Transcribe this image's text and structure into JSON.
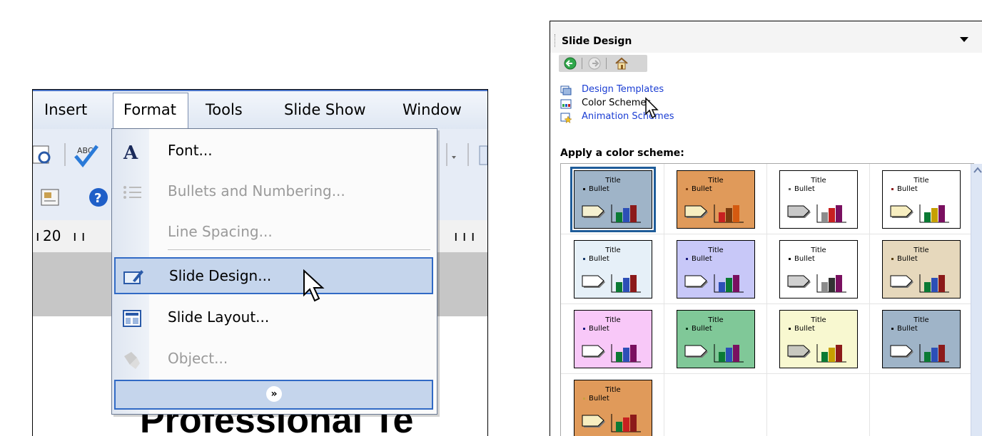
{
  "menubar": {
    "items": [
      "Insert",
      "Format",
      "Tools",
      "Slide Show",
      "Window"
    ]
  },
  "ruler": {
    "mark": "20"
  },
  "format_menu": {
    "items": [
      {
        "label": "Font...",
        "disabled": false,
        "icon": "font-icon"
      },
      {
        "label": "Bullets and Numbering...",
        "disabled": true,
        "icon": "bullets-icon"
      },
      {
        "label": "Line Spacing...",
        "disabled": true,
        "icon": ""
      },
      {
        "label": "Slide Design...",
        "disabled": false,
        "highlighted": true,
        "icon": "slide-design-icon"
      },
      {
        "label": "Slide Layout...",
        "disabled": false,
        "icon": "slide-layout-icon"
      },
      {
        "label": "Object...",
        "disabled": true,
        "icon": "object-icon"
      }
    ],
    "expand_icon": "chevron-double-down-icon"
  },
  "slide": {
    "title_fragment": "Professional Te"
  },
  "task_pane": {
    "title": "Slide Design",
    "links": [
      {
        "label": "Design Templates",
        "link": true
      },
      {
        "label": "Color Schemes",
        "link": false
      },
      {
        "label": "Animation Schemes",
        "link": true
      }
    ],
    "apply_label": "Apply a color scheme:",
    "thumbnail_title": "Title",
    "thumbnail_bullet": "Bullet",
    "schemes": [
      {
        "bg": "#9fb4c8",
        "bullet": "#111111",
        "arrow": "#f5f0d0",
        "bars": [
          "#0b7a34",
          "#2c4fb7",
          "#8c1a1a"
        ],
        "selected": true
      },
      {
        "bg": "#e09a5a",
        "bullet": "#7a3c10",
        "arrow": "#f7eec0",
        "bars": [
          "#c72020",
          "#7a3c10",
          "#d45a10"
        ],
        "selected": false
      },
      {
        "bg": "#ffffff",
        "bullet": "#666666",
        "arrow": "#c8c8c8",
        "bars": [
          "#8c8c8c",
          "#c72020",
          "#7a1060"
        ],
        "selected": false
      },
      {
        "bg": "#ffffff",
        "bullet": "#8c1a1a",
        "arrow": "#f7eec0",
        "bars": [
          "#0b7a34",
          "#c6a000",
          "#7a1060"
        ],
        "selected": false
      },
      {
        "bg": "#e6f0f8",
        "bullet": "#1a3a6a",
        "arrow": "#ffffff",
        "bars": [
          "#0b7a34",
          "#2c4fb7",
          "#8c1a1a"
        ],
        "selected": false
      },
      {
        "bg": "#c8c8f8",
        "bullet": "#1a1a80",
        "arrow": "#ffffff",
        "bars": [
          "#2c4fb7",
          "#0b7a34",
          "#7a1060"
        ],
        "selected": false
      },
      {
        "bg": "#ffffff",
        "bullet": "#111111",
        "arrow": "#d0d0d0",
        "bars": [
          "#8c8c8c",
          "#333333",
          "#7a1060"
        ],
        "selected": false
      },
      {
        "bg": "#e6d8bc",
        "bullet": "#5a4010",
        "arrow": "#ffffff",
        "bars": [
          "#0b7a34",
          "#2c4fb7",
          "#8c1a1a"
        ],
        "selected": false
      },
      {
        "bg": "#f8c8f8",
        "bullet": "#1a1a80",
        "arrow": "#ffffff",
        "bars": [
          "#0b7a34",
          "#2c4fb7",
          "#7a1060"
        ],
        "selected": false
      },
      {
        "bg": "#80c898",
        "bullet": "#0b3a1a",
        "arrow": "#ffffff",
        "bars": [
          "#0b7a34",
          "#2c4fb7",
          "#7a1060"
        ],
        "selected": false
      },
      {
        "bg": "#f8f8d0",
        "bullet": "#111111",
        "arrow": "#c8c8c0",
        "bars": [
          "#0b7a34",
          "#c6a000",
          "#8c1a1a"
        ],
        "selected": false
      },
      {
        "bg": "#9fb4c8",
        "bullet": "#111111",
        "arrow": "#ffffff",
        "bars": [
          "#0b7a34",
          "#2c4fb7",
          "#8c1a1a"
        ],
        "selected": false
      },
      {
        "bg": "#e09a5a",
        "bullet": "#c8a040",
        "arrow": "#f7eec0",
        "bars": [
          "#0b7a34",
          "#c72020",
          "#8c1a1a"
        ],
        "selected": false
      }
    ]
  }
}
